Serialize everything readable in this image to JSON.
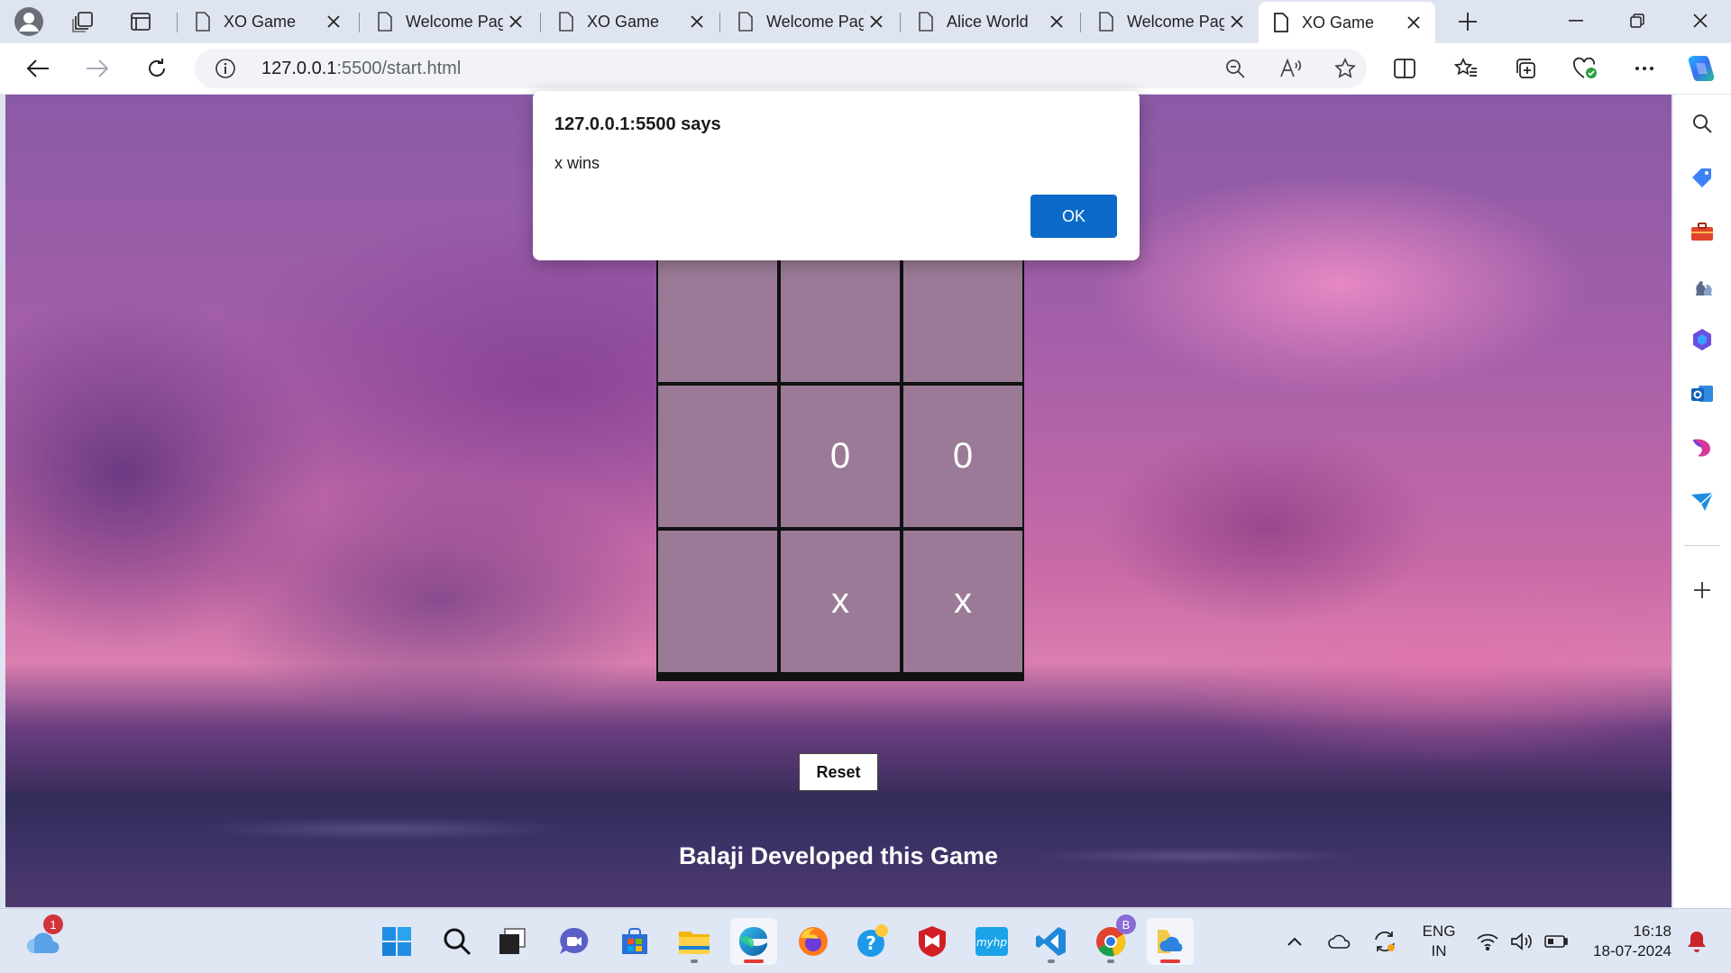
{
  "tabs": [
    {
      "title": "XO Game",
      "active": false
    },
    {
      "title": "Welcome Page",
      "active": false
    },
    {
      "title": "XO Game",
      "active": false
    },
    {
      "title": "Welcome Page",
      "active": false
    },
    {
      "title": "Alice World",
      "active": false
    },
    {
      "title": "Welcome Page",
      "active": false
    },
    {
      "title": "XO Game",
      "active": true
    }
  ],
  "address": {
    "host": "127.0.0.1",
    "rest": ":5500/start.html"
  },
  "game": {
    "cells": [
      "",
      "",
      "",
      "",
      "0",
      "0",
      "",
      "x",
      "x"
    ],
    "reset_label": "Reset",
    "credit": "Balaji Developed this Game"
  },
  "alert": {
    "title": "127.0.0.1:5500 says",
    "message": "x wins",
    "ok_label": "OK"
  },
  "taskbar": {
    "weather_badge": "1",
    "chrome_badge": "B",
    "lang_line1": "ENG",
    "lang_line2": "IN",
    "time": "16:18",
    "date": "18-07-2024"
  },
  "colors": {
    "accent": "#0b6ac7",
    "cell": "#9a7a96",
    "tab_bg": "#dfe4f1"
  }
}
